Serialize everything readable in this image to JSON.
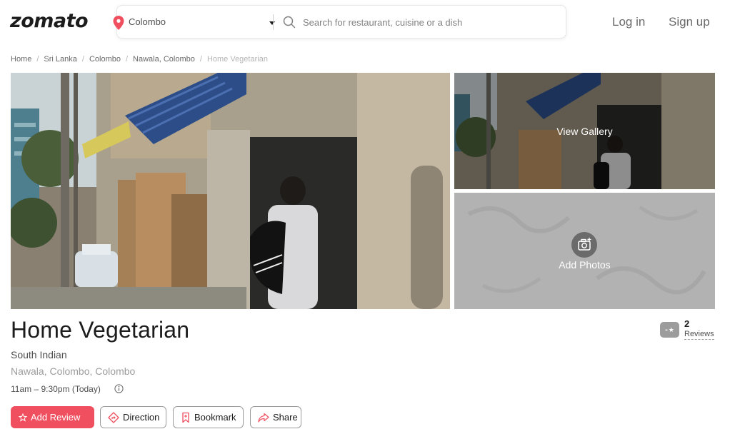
{
  "header": {
    "logo": "zomato",
    "location": "Colombo",
    "search_placeholder": "Search for restaurant, cuisine or a dish",
    "login": "Log in",
    "signup": "Sign up"
  },
  "breadcrumb": [
    "Home",
    "Sri Lanka",
    "Colombo",
    "Nawala, Colombo",
    "Home Vegetarian"
  ],
  "gallery": {
    "view_gallery": "View Gallery",
    "add_photos": "Add Photos"
  },
  "restaurant": {
    "name": "Home Vegetarian",
    "cuisine": "South Indian",
    "locality": "Nawala, Colombo, Colombo",
    "timing": "11am – 9:30pm (Today)",
    "rating": "-",
    "review_count": "2",
    "review_label": "Reviews"
  },
  "actions": {
    "add_review": "Add Review",
    "direction": "Direction",
    "bookmark": "Bookmark",
    "share": "Share"
  },
  "colors": {
    "brand": "#ef4f5f",
    "text": "#1c1c1c",
    "muted": "#9c9c9c"
  },
  "icons": {
    "location": "map-pin-icon",
    "caret": "caret-down-icon",
    "search": "search-icon",
    "info": "info-icon",
    "star": "star-icon",
    "direction": "direction-icon",
    "bookmark": "bookmark-icon",
    "share": "share-icon",
    "camera": "camera-add-icon"
  }
}
